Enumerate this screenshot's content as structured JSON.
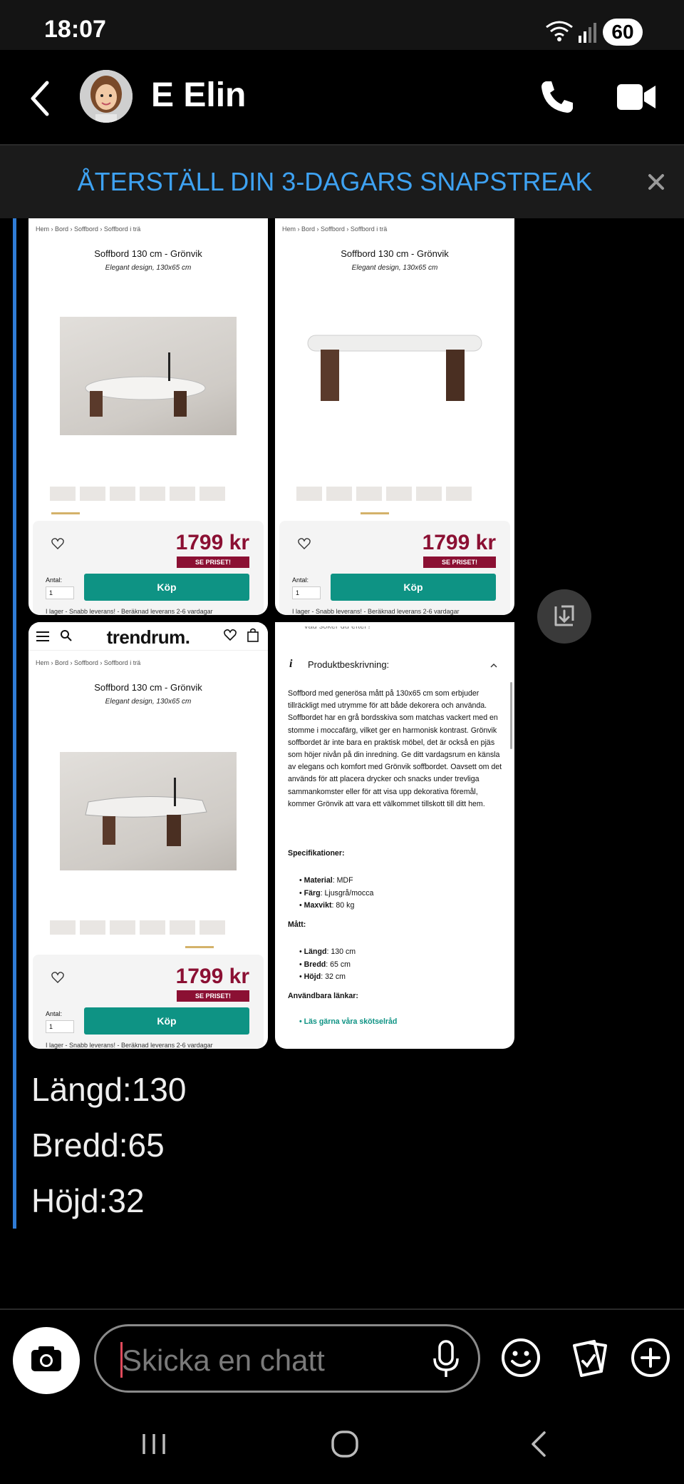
{
  "status_bar": {
    "time": "18:07",
    "battery": "60"
  },
  "header": {
    "contact_name": "E Elin"
  },
  "banner": {
    "text": "ÅTERSTÄLL DIN 3-DAGARS SNAPSTREAK"
  },
  "product": {
    "breadcrumb": [
      "Hem",
      "Bord",
      "Soffbord",
      "Soffbord i trä"
    ],
    "title": "Soffbord 130 cm - Grönvik",
    "subtitle": "Elegant design, 130x65 cm",
    "price": "1799 kr",
    "price_badge": "SE PRISET!",
    "qty_label": "Antal:",
    "qty_value": "1",
    "buy_label": "Köp",
    "stock_text": "I lager - Snabb leverans! - Beräknad leverans 2-6 vardagar",
    "logo": "trendrum.",
    "search_placeholder": "Vad söker du efter?"
  },
  "description": {
    "heading": "Produktbeskrivning:",
    "body": "Soffbord med generösa mått på 130x65 cm som erbjuder tillräckligt med utrymme för att både dekorera och använda. Soffbordet har en grå bordsskiva som matchas vackert med en stomme i moccafärg, vilket ger en harmonisk kontrast. Grönvik soffbordet är inte bara en praktisk möbel, det är också en pjäs som höjer nivån på din inredning. Ge ditt vardagsrum en känsla av elegans och komfort med Grönvik soffbordet. Oavsett om det används för att placera drycker och snacks under trevliga sammankomster eller för att visa upp dekorativa föremål, kommer Grönvik att vara ett välkommet tillskott till ditt hem.",
    "spec_heading": "Specifikationer:",
    "specs": [
      {
        "key": "Material",
        "value": ": MDF"
      },
      {
        "key": "Färg",
        "value": ": Ljusgrå/mocca"
      },
      {
        "key": "Maxvikt",
        "value": ": 80 kg"
      }
    ],
    "dim_heading": "Mått:",
    "dims": [
      {
        "key": "Längd",
        "value": ": 130 cm"
      },
      {
        "key": "Bredd",
        "value": ": 65 cm"
      },
      {
        "key": "Höjd",
        "value": ": 32 cm"
      }
    ],
    "links_heading": "Användbara länkar:",
    "link": "Läs gärna våra skötselråd"
  },
  "messages": [
    "Längd:130",
    "Bredd:65",
    "Höjd:32"
  ],
  "input": {
    "placeholder": "Skicka en chatt"
  },
  "colors": {
    "accent_blue": "#3ea2f2",
    "price_red": "#8b1033",
    "buy_green": "#0e9384",
    "chat_bar": "#2f7cd6"
  }
}
